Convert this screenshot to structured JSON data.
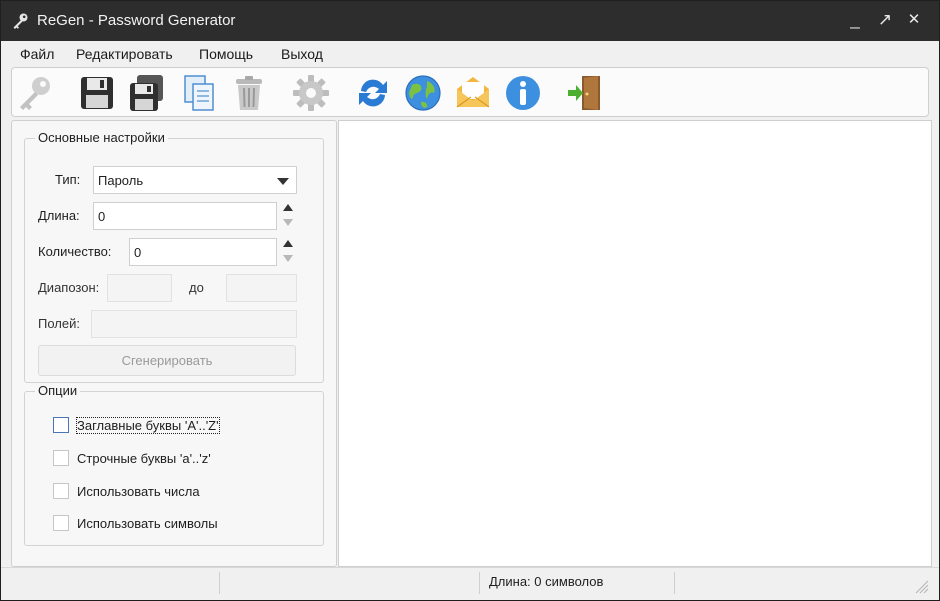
{
  "window": {
    "title": "ReGen - Password Generator",
    "controls": {
      "minimize": "_",
      "maximize": "↗",
      "close": "✕"
    }
  },
  "menu": [
    "Файл",
    "Редактировать",
    "Помощь",
    "Выход"
  ],
  "toolbar": {
    "icons": [
      "key-icon",
      "save-icon",
      "save-as-icon",
      "copy-icon",
      "trash-icon",
      "settings-gear-icon",
      "refresh-icon",
      "globe-icon",
      "mail-icon",
      "info-icon",
      "exit-door-icon"
    ]
  },
  "basic": {
    "title": "Основные настройки",
    "type_label": "Тип:",
    "type_value": "Пароль",
    "length_label": "Длина:",
    "length_value": "0",
    "count_label": "Количество:",
    "count_value": "0",
    "range_label": "Диапозон:",
    "range_to_label": "до",
    "fields_label": "Полей:",
    "generate_button": "Сгенерировать"
  },
  "options": {
    "title": "Опции",
    "items": [
      {
        "label": "Заглавные буквы 'A'..'Z'",
        "checked": false
      },
      {
        "label": "Строчные буквы 'a'..'z'",
        "checked": false
      },
      {
        "label": "Использовать числа",
        "checked": false
      },
      {
        "label": "Использовать символы",
        "checked": false
      }
    ]
  },
  "status": {
    "length_text": "Длина: 0 символов"
  },
  "colors": {
    "titlebar": "#2d2d2d",
    "accent_blue": "#2a7bd4",
    "panel": "#f7f7f7"
  }
}
